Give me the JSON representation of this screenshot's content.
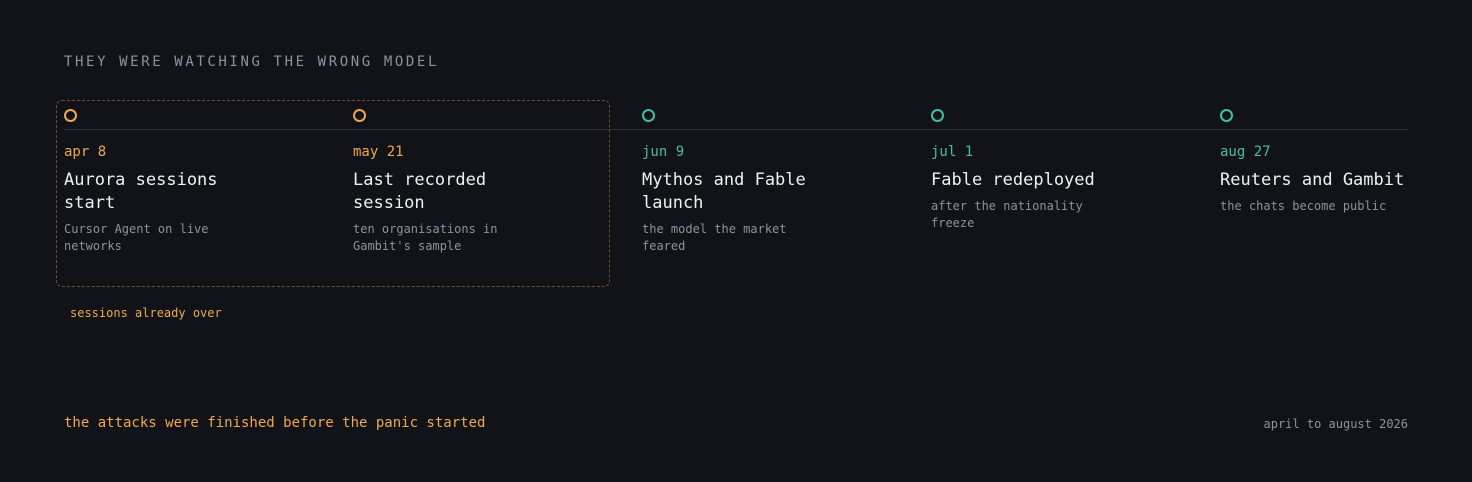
{
  "header": {
    "kicker": "THEY WERE WATCHING THE WRONG MODEL"
  },
  "bracket": {
    "label": "sessions already over"
  },
  "colors": {
    "background": "#111318",
    "accent_orange": "#f0a94a",
    "accent_teal": "#3fbfa9",
    "text_primary": "#eef0f3",
    "text_muted": "#8a93a3"
  },
  "events": [
    {
      "date": "apr 8",
      "title": "Aurora sessions start",
      "desc": "Cursor Agent on live networks",
      "tone": "orange"
    },
    {
      "date": "may 21",
      "title": "Last recorded session",
      "desc": "ten organisations in Gambit's sample",
      "tone": "orange"
    },
    {
      "date": "jun 9",
      "title": "Mythos and Fable launch",
      "desc": "the model the market feared",
      "tone": "teal"
    },
    {
      "date": "jul 1",
      "title": "Fable redeployed",
      "desc": "after the nationality freeze",
      "tone": "teal"
    },
    {
      "date": "aug 27",
      "title": "Reuters and Gambit",
      "desc": "the chats become public",
      "tone": "teal"
    }
  ],
  "footer": {
    "conclusion": "the attacks were finished before the panic started",
    "range": "april to august 2026"
  }
}
